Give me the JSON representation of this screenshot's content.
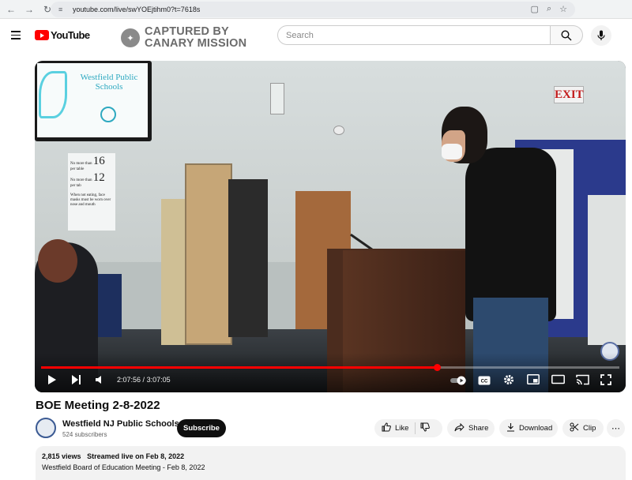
{
  "browser": {
    "url": "youtube.com/live/swYOEjtihm0?t=7618s"
  },
  "header": {
    "logo_text": "YouTube",
    "overlay_text_line1": "CAPTURED BY",
    "overlay_text_line2": "CANARY MISSION",
    "search_placeholder": "Search"
  },
  "video": {
    "tv_title": "Westfield Public Schools",
    "poster_lines": [
      "No more than",
      "16",
      "per table",
      "No more than",
      "12",
      "per tab"
    ],
    "poster_footer": "When not eating, face masks must be worn over nose and mouth",
    "exit_sign": "EXIT",
    "time_current": "2:07:56",
    "time_separator": "/",
    "time_total": "3:07:05",
    "progress": 0.6846,
    "buffered": 0.6846
  },
  "info": {
    "title": "BOE Meeting 2-8-2022",
    "channel_name": "Westfield NJ Public Schools",
    "subscribers": "524 subscribers",
    "subscribe_label": "Subscribe",
    "like_label": "Like",
    "share_label": "Share",
    "download_label": "Download",
    "clip_label": "Clip",
    "views": "2,815 views",
    "streamed": "Streamed live on Feb 8, 2022",
    "description": "Westfield Board of Education Meeting - Feb 8, 2022"
  },
  "colors": {
    "brand_red": "#ff0000",
    "text_primary": "#0f0f0f",
    "text_secondary": "#606060",
    "pill_bg": "#f2f2f2"
  }
}
